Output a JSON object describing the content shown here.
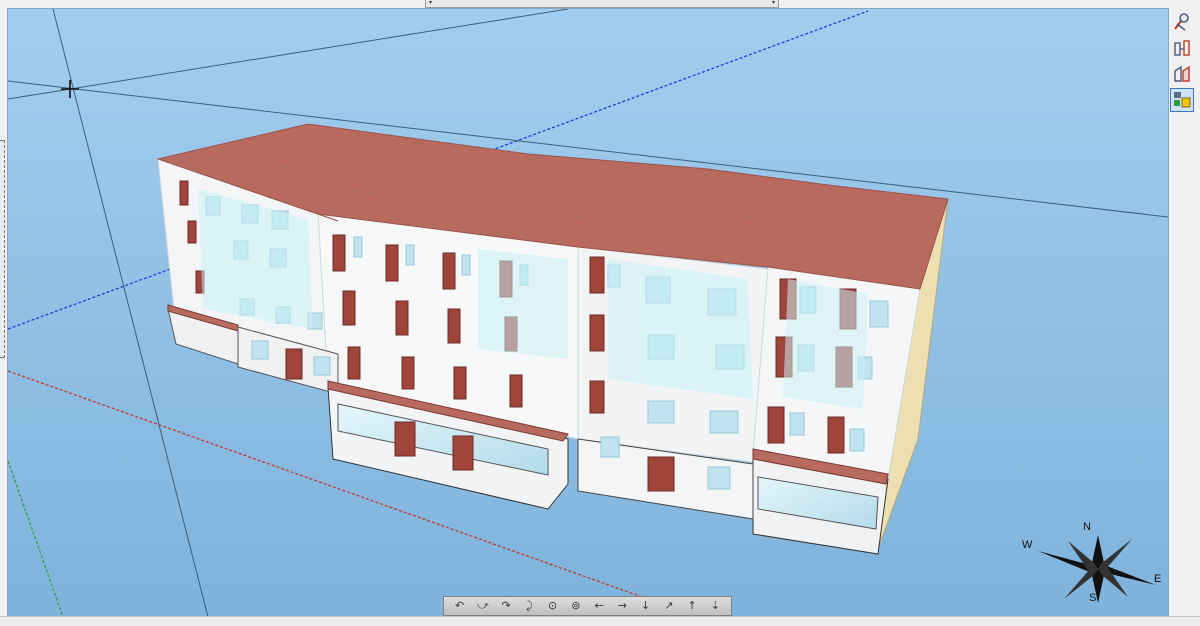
{
  "viewport": {
    "compass": {
      "north": "N",
      "south": "S",
      "east": "E",
      "west": "W"
    }
  },
  "right_toolbar": {
    "tools": [
      {
        "icon": "measure-icon"
      },
      {
        "icon": "dimension-icon"
      },
      {
        "icon": "section-icon"
      },
      {
        "icon": "layer-display-icon",
        "active": true
      }
    ]
  },
  "nav_toolbar": {
    "buttons": [
      {
        "icon": "orbit-left-icon",
        "glyph": "↶"
      },
      {
        "icon": "orbit-up-icon",
        "glyph": "⤻"
      },
      {
        "icon": "orbit-right-icon",
        "glyph": "↷"
      },
      {
        "icon": "orbit-down-icon",
        "glyph": "⤸"
      },
      {
        "icon": "zoom-icon",
        "glyph": "⊙"
      },
      {
        "icon": "look-around-icon",
        "glyph": "⊚"
      },
      {
        "icon": "pan-left-icon",
        "glyph": "←"
      },
      {
        "icon": "pan-right-icon",
        "glyph": "→"
      },
      {
        "icon": "pan-down-icon",
        "glyph": "↓"
      },
      {
        "icon": "walk-forward-icon",
        "glyph": "↗"
      },
      {
        "icon": "pan-up-icon",
        "glyph": "↑"
      },
      {
        "icon": "descend-icon",
        "glyph": "⇣"
      }
    ]
  },
  "colors": {
    "sky": "#92c1e6",
    "roof": "#b96a5e",
    "wall": "#f2f4f5",
    "door": "#a0453c",
    "glass": "#cfe8f2"
  }
}
